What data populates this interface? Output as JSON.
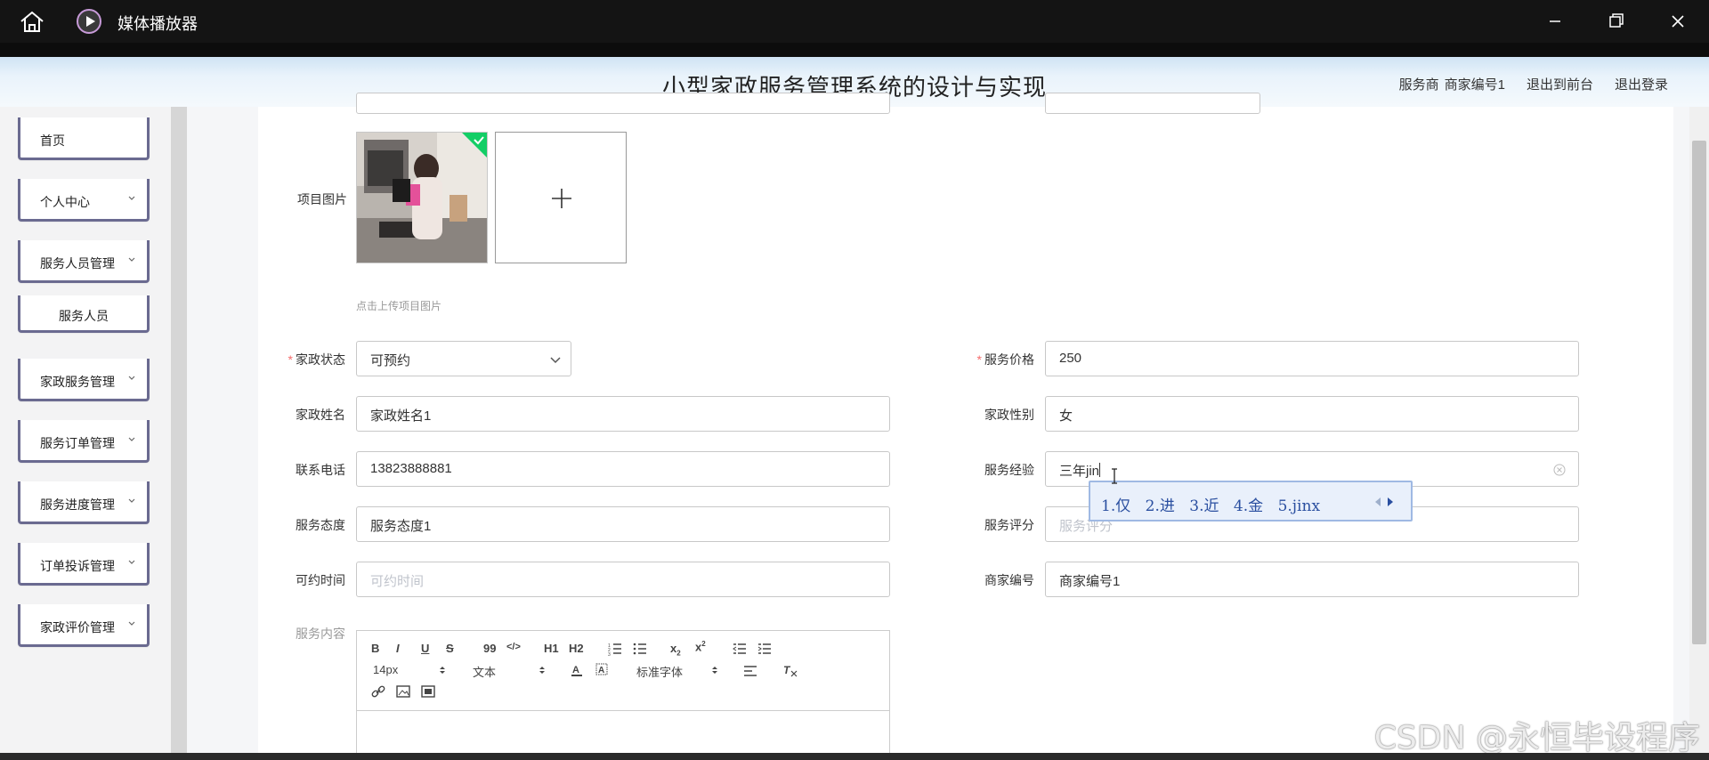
{
  "player": {
    "title": "媒体播放器"
  },
  "header": {
    "system_title": "小型家政服务管理系统的设计与实现",
    "role": "服务商",
    "user": "商家编号1",
    "front_link": "退出到前台",
    "logout_link": "退出登录"
  },
  "sidebar": {
    "items": [
      {
        "label": "首页"
      },
      {
        "label": "个人中心"
      },
      {
        "label": "服务人员管理"
      },
      {
        "label": "服务人员"
      },
      {
        "label": "家政服务管理"
      },
      {
        "label": "服务订单管理"
      },
      {
        "label": "服务进度管理"
      },
      {
        "label": "订单投诉管理"
      },
      {
        "label": "家政评价管理"
      }
    ]
  },
  "form": {
    "image_label": "项目图片",
    "upload_tip": "点击上传项目图片",
    "status_label": "家政状态",
    "status_value": "可预约",
    "price_label": "服务价格",
    "price_value": "250",
    "name_label": "家政姓名",
    "name_value": "家政姓名1",
    "gender_label": "家政性别",
    "gender_value": "女",
    "phone_label": "联系电话",
    "phone_value": "13823888881",
    "experience_label": "服务经验",
    "experience_value": "三年jin",
    "attitude_label": "服务态度",
    "attitude_value": "服务态度1",
    "rating_label": "服务评分",
    "rating_placeholder": "服务评分",
    "time_label": "可约时间",
    "time_placeholder": "可约时间",
    "merchant_label": "商家编号",
    "merchant_value": "商家编号1",
    "content_label": "服务内容"
  },
  "ime": {
    "candidates": [
      "1.仅",
      "2.进",
      "3.近",
      "4.金",
      "5.jinx"
    ]
  },
  "editor": {
    "font_size": "14px",
    "paragraph": "文本",
    "font_family": "标准字体",
    "buttons": [
      "B",
      "I",
      "U",
      "S",
      "99",
      "</>",
      "H1",
      "H2",
      "ol",
      "ul",
      "x2",
      "x2",
      "outdent",
      "indent"
    ]
  },
  "watermark": "CSDN @永恒毕设程序",
  "colors": {
    "required": "#f56c6c",
    "menu_border": "#6a6a90",
    "ime_text": "#2a4fa0",
    "player_bar": "#141414"
  }
}
